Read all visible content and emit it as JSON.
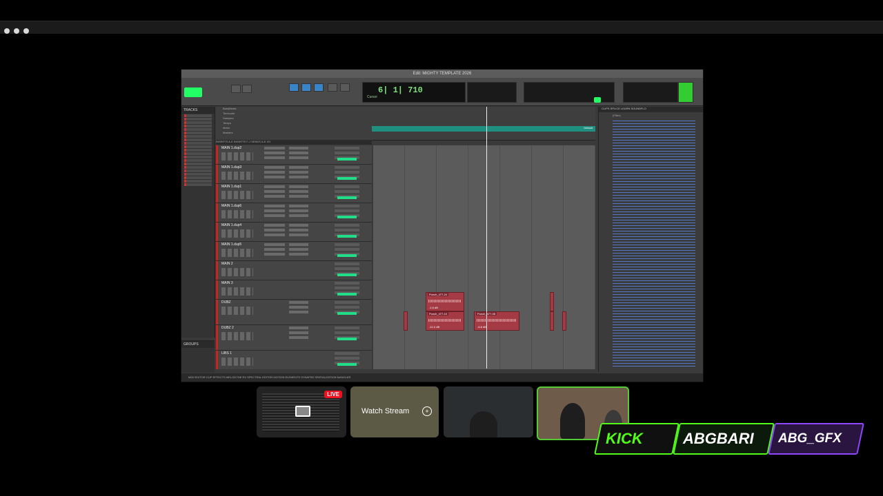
{
  "window": {
    "title": "Edit: MIGHTY TEMPLATE 2026"
  },
  "counter": {
    "main": "6| 1| 710",
    "sub": "Cursor"
  },
  "sidebar": {
    "tracks_header": "TRACKS",
    "groups_header": "GROUPS"
  },
  "rulers": [
    "Bars|Beats",
    "Timecode",
    "Samples",
    "Tempo",
    "Meter",
    "Markers"
  ],
  "marker": {
    "label": "Default"
  },
  "mix_header": "INSERTS A-E   INSERTS F-J   SENDS A-E   I/O",
  "tracks": [
    {
      "name": "MAIN 1.dup2"
    },
    {
      "name": "MAIN 1.dup3"
    },
    {
      "name": "MAIN 1.dup1"
    },
    {
      "name": "MAIN 1.dup6"
    },
    {
      "name": "MAIN 1.dup4"
    },
    {
      "name": "MAIN 1.dup5"
    },
    {
      "name": "MAIN 2"
    },
    {
      "name": "MAIN 3"
    },
    {
      "name": "DUBZ"
    },
    {
      "name": "DUBZ 2"
    },
    {
      "name": "LIBS 1"
    }
  ],
  "clips": [
    {
      "name": "Punch_477-24",
      "vol": "-1.6 dB"
    },
    {
      "name": "Punch_477-10",
      "vol": "-12.2 dB"
    },
    {
      "name": "Punch_477-05",
      "vol": "-6.8 dB"
    }
  ],
  "clips_panel": {
    "tabs": "CLIPS   SPLICE   LEARN   SOUNDFLO",
    "filter": "(Filter)"
  },
  "bottom_tabs": "MIDI EDITOR   CLIP EFFECTS   MELODYNE   RX SPECTRAL EDITOR   MOTION ELEMENTS   SYNAPSE   SPATIALIZATION   MANGLER",
  "stream": {
    "live_badge": "LIVE",
    "watch_label": "Watch Stream"
  },
  "socials": {
    "kick": "KICK",
    "handle": "ABGBARI",
    "twitch": "ABG_GFX"
  },
  "colors": {
    "accent_green": "#53fc18",
    "twitch_purple": "#9146ff",
    "clip_red": "#a33a44",
    "live_red": "#e11"
  }
}
